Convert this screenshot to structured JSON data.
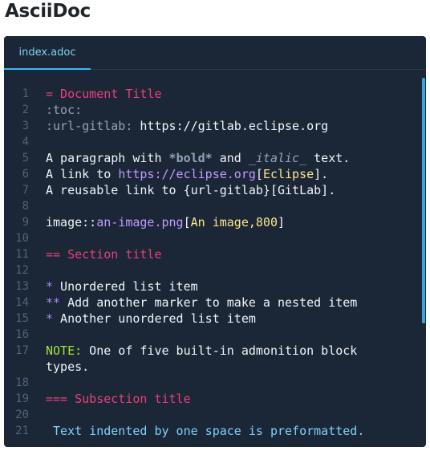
{
  "page": {
    "title": "AsciiDoc"
  },
  "editor": {
    "tab_label": "index.adoc",
    "lines": [
      {
        "num": "1",
        "segments": [
          {
            "cls": "c-heading",
            "text": "= Document Title"
          }
        ]
      },
      {
        "num": "2",
        "segments": [
          {
            "cls": "c-attr",
            "text": ":toc:"
          }
        ]
      },
      {
        "num": "3",
        "segments": [
          {
            "cls": "c-attr",
            "text": ":url-gitlab:"
          },
          {
            "cls": "c-text",
            "text": " https://gitlab.eclipse.org"
          }
        ]
      },
      {
        "num": "4",
        "segments": []
      },
      {
        "num": "5",
        "segments": [
          {
            "cls": "c-text",
            "text": "A paragraph with "
          },
          {
            "cls": "c-bold",
            "text": "*bold*"
          },
          {
            "cls": "c-text",
            "text": " and "
          },
          {
            "cls": "c-italic",
            "text": "_italic_"
          },
          {
            "cls": "c-text",
            "text": " text."
          }
        ]
      },
      {
        "num": "6",
        "segments": [
          {
            "cls": "c-text",
            "text": "A link to "
          },
          {
            "cls": "c-link",
            "text": "https://eclipse.org"
          },
          {
            "cls": "c-text",
            "text": "["
          },
          {
            "cls": "c-linktext",
            "text": "Eclipse"
          },
          {
            "cls": "c-text",
            "text": "]."
          }
        ]
      },
      {
        "num": "7",
        "segments": [
          {
            "cls": "c-text",
            "text": "A reusable link to {url-gitlab}[GitLab]."
          }
        ]
      },
      {
        "num": "8",
        "segments": []
      },
      {
        "num": "9",
        "segments": [
          {
            "cls": "c-text",
            "text": "image::"
          },
          {
            "cls": "c-link",
            "text": "an-image.png"
          },
          {
            "cls": "c-text",
            "text": "["
          },
          {
            "cls": "c-linktext",
            "text": "An image,800"
          },
          {
            "cls": "c-text",
            "text": "]"
          }
        ]
      },
      {
        "num": "10",
        "segments": []
      },
      {
        "num": "11",
        "segments": [
          {
            "cls": "c-heading",
            "text": "== Section title"
          }
        ]
      },
      {
        "num": "12",
        "segments": []
      },
      {
        "num": "13",
        "segments": [
          {
            "cls": "c-bullet",
            "text": "*"
          },
          {
            "cls": "c-text",
            "text": " Unordered list item"
          }
        ]
      },
      {
        "num": "14",
        "segments": [
          {
            "cls": "c-bullet",
            "text": "**"
          },
          {
            "cls": "c-text",
            "text": " Add another marker to make a nested item"
          }
        ]
      },
      {
        "num": "15",
        "segments": [
          {
            "cls": "c-bullet",
            "text": "*"
          },
          {
            "cls": "c-text",
            "text": " Another unordered list item"
          }
        ]
      },
      {
        "num": "16",
        "segments": []
      },
      {
        "num": "17",
        "tall": true,
        "segments": [
          {
            "cls": "c-note",
            "text": "NOTE:"
          },
          {
            "cls": "c-text",
            "text": " One of five built-in admonition block\ntypes."
          }
        ]
      },
      {
        "num": "18",
        "segments": []
      },
      {
        "num": "19",
        "segments": [
          {
            "cls": "c-heading",
            "text": "=== Subsection title"
          }
        ]
      },
      {
        "num": "20",
        "segments": []
      },
      {
        "num": "21",
        "segments": [
          {
            "cls": "c-pre",
            "text": " Text indented by one space is preformatted."
          }
        ]
      }
    ]
  },
  "colors": {
    "editor_bg": "#1b2637",
    "heading": "#ec3e7c",
    "link": "#c19cff",
    "link_text": "#fde68a",
    "note": "#a3e635",
    "preformatted": "#7dd3fc",
    "scrollbar": "#3aa3e3"
  }
}
